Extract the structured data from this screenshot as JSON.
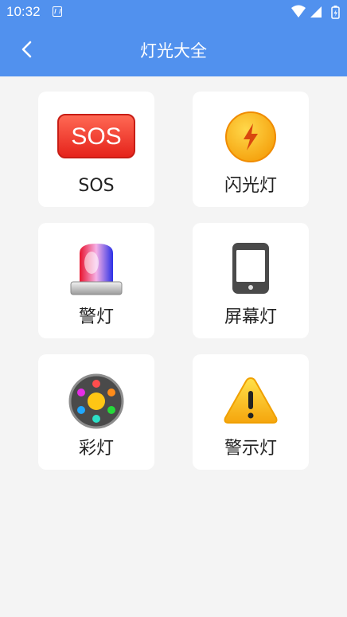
{
  "status_bar": {
    "time": "10:32"
  },
  "header": {
    "title": "灯光大全"
  },
  "items": [
    {
      "label": "SOS",
      "icon": "sos-icon",
      "icon_text": "SOS"
    },
    {
      "label": "闪光灯",
      "icon": "flash-icon"
    },
    {
      "label": "警灯",
      "icon": "police-light-icon"
    },
    {
      "label": "屏幕灯",
      "icon": "phone-screen-icon"
    },
    {
      "label": "彩灯",
      "icon": "color-light-icon"
    },
    {
      "label": "警示灯",
      "icon": "warning-icon"
    }
  ],
  "colors": {
    "header": "#5191ee",
    "background": "#f4f4f4",
    "card": "#ffffff"
  }
}
